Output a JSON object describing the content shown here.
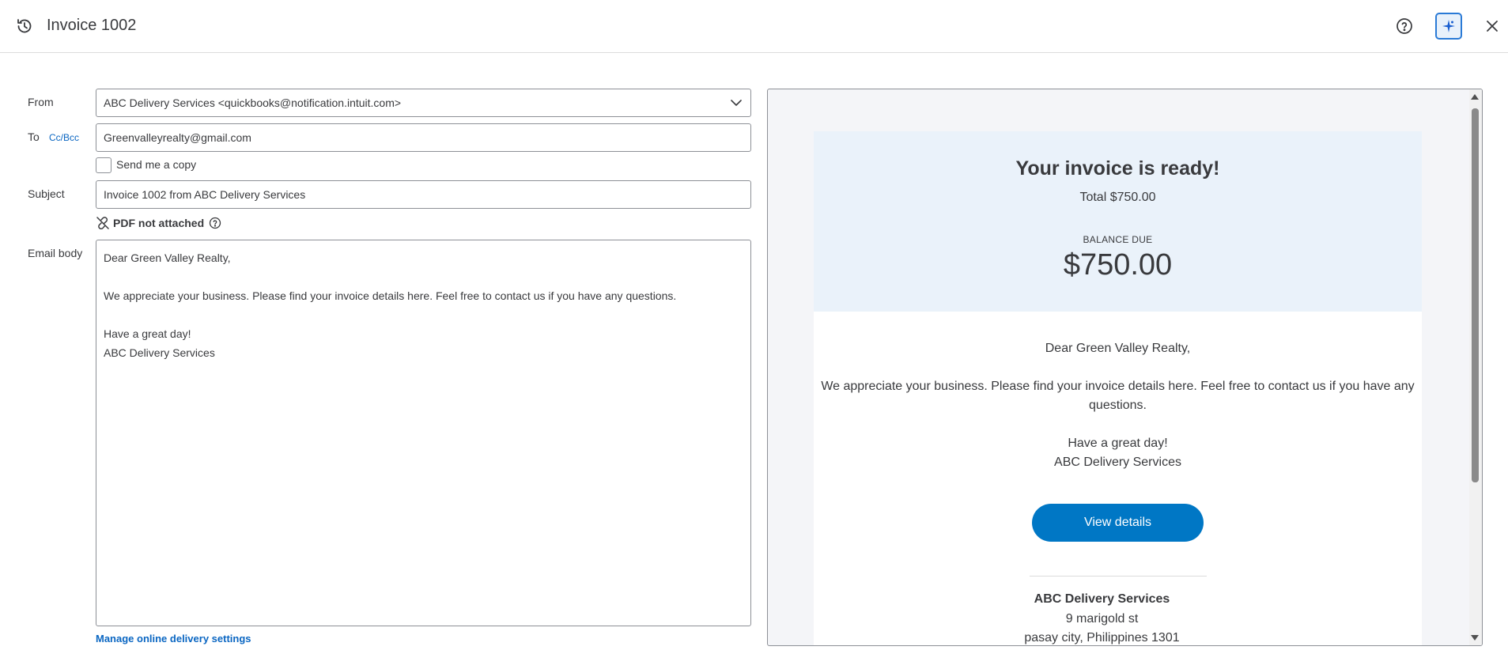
{
  "header": {
    "title": "Invoice 1002",
    "history_icon": "history-icon",
    "help_icon": "help-circle-icon",
    "assistant_icon": "assistant-sparkle-icon",
    "close_icon": "close-icon",
    "accent_color": "#0077c5"
  },
  "form": {
    "from_label": "From",
    "from_value": "ABC Delivery Services <quickbooks@notification.intuit.com>",
    "to_label": "To",
    "ccbcc_label": "Cc/Bcc",
    "to_value": "Greenvalleyrealty@gmail.com",
    "send_copy_label": "Send me a copy",
    "send_copy_checked": false,
    "subject_label": "Subject",
    "subject_value": "Invoice 1002 from ABC Delivery Services",
    "pdf_status": "PDF not attached",
    "email_body_label": "Email body",
    "email_body_lines": [
      "Dear Green Valley Realty,",
      "",
      "We appreciate your business. Please find your invoice details here. Feel free to contact us if you have any questions.",
      "",
      "Have a great day!",
      "ABC Delivery Services"
    ],
    "manage_link": "Manage online delivery settings"
  },
  "preview": {
    "heading": "Your invoice is ready!",
    "total": "Total $750.00",
    "balance_due_label": "BALANCE DUE",
    "balance_due_amount": "$750.00",
    "greeting": "Dear Green Valley Realty,",
    "message_line1": "We appreciate your business. Please find your invoice details here. Feel free to contact us if you have any",
    "message_line2": "questions.",
    "signoff1": "Have a great day!",
    "signoff2": "ABC Delivery Services",
    "button_label": "View details",
    "company_name": "ABC Delivery Services",
    "address_line1": "9 marigold st",
    "address_line2": "pasay city, Philippines 1301"
  }
}
